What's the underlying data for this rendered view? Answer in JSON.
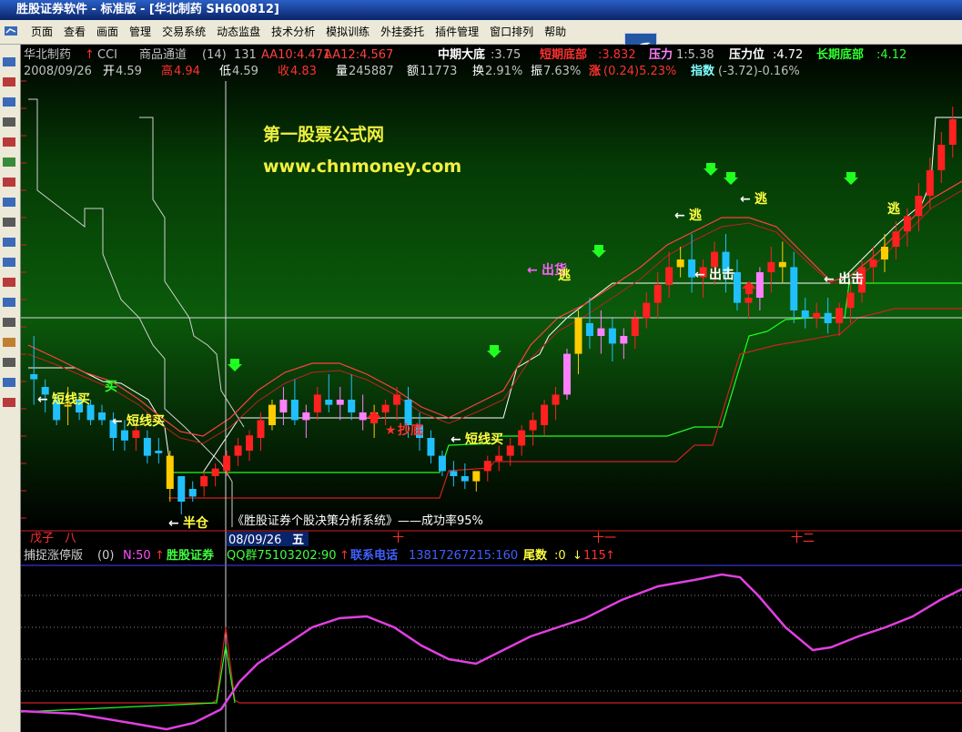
{
  "titlebar": {
    "text": "胜股证券软件 - 标准版 - [华北制药 SH600812]"
  },
  "menu": [
    "页面",
    "查看",
    "画面",
    "管理",
    "交易系统",
    "动态监盘",
    "技术分析",
    "模拟训练",
    "外挂委托",
    "插件管理",
    "窗口排列",
    "帮助"
  ],
  "header1": {
    "name": "华北制药",
    "ind": "CCI",
    "indname": "商品通道",
    "param": "(14)",
    "cci": "131",
    "aa10": "AA10:4.471",
    "aa12": "AA12:4.567",
    "mid_label": "中期大底",
    "mid_val": ":3.75",
    "short_label": "短期底部",
    "short_val": ":3.832",
    "press_label": "压力",
    "press_val": "1:5.38",
    "pos_label": "压力位",
    "pos_val": ":4.72",
    "long_label": "长期底部",
    "long_val": ":4.12"
  },
  "header2": {
    "date": "2008/09/26",
    "open_l": "开",
    "open_v": "4.59",
    "high_l": "高",
    "high_v": "4.94",
    "low_l": "低",
    "low_v": "4.59",
    "close_l": "收",
    "close_v": "4.83",
    "vol_l": "量",
    "vol_v": "245887",
    "amt_l": "额",
    "amt_v": "11773",
    "turn_l": "换",
    "turn_v": "2.91%",
    "amp_l": "振",
    "amp_v": "7.63%",
    "chg_l": "涨",
    "chg_v": "(0.24)5.23%",
    "idx_l": "指数",
    "idx_v": "(-3.72)-0.16%"
  },
  "watermark": {
    "line1": "第一股票公式网",
    "line2": "www.chnmoney.com"
  },
  "bottom_caption": "《胜股证券个股决策分析系统》——成功率95%",
  "labels": {
    "short_buy": "短线买",
    "buy": "买",
    "half_pos": "半仓",
    "copy_bottom": "抄底",
    "escape": "逃",
    "out": "出击",
    "outgoods": "出货"
  },
  "months": {
    "m1": "戊子",
    "m2": "八",
    "m3": "十",
    "m4": "十一",
    "m5": "十二"
  },
  "cursor_date": "08/09/26",
  "cursor_day": "五",
  "sub_header": {
    "name": "捕捉涨停版",
    "param": "(0)",
    "n": "N:50",
    "brand": "胜股证券",
    "qq": "QQ群75103202:90",
    "tel_l": "联系电话",
    "tel_v": "13817267215:160",
    "tail_l": "尾数",
    "tail_v": ":0",
    "last": "115"
  },
  "chart_data": {
    "type": "candlestick",
    "candles": [
      [
        4.3,
        4.45,
        4.28,
        4.18
      ],
      [
        4.25,
        4.28,
        4.22,
        4.15
      ],
      [
        4.2,
        4.22,
        4.12,
        4.1
      ],
      [
        4.18,
        4.25,
        4.18,
        4.1
      ],
      [
        4.2,
        4.22,
        4.15,
        4.12
      ],
      [
        4.18,
        4.2,
        4.12,
        4.1
      ],
      [
        4.15,
        4.18,
        4.12,
        4.1
      ],
      [
        4.12,
        4.15,
        4.05,
        4.0
      ],
      [
        4.08,
        4.12,
        4.04,
        4.0
      ],
      [
        4.05,
        4.1,
        4.08,
        4.0
      ],
      [
        4.05,
        4.08,
        3.98,
        3.95
      ],
      [
        4.0,
        4.05,
        3.99,
        3.95
      ],
      [
        3.98,
        4.0,
        3.85,
        3.8
      ],
      [
        3.9,
        3.9,
        3.8,
        3.75
      ],
      [
        3.85,
        3.88,
        3.82,
        3.8
      ],
      [
        3.86,
        3.92,
        3.9,
        3.82
      ],
      [
        3.9,
        3.95,
        3.93,
        3.86
      ],
      [
        3.92,
        4.0,
        3.98,
        3.9
      ],
      [
        3.98,
        4.05,
        4.02,
        3.94
      ],
      [
        4.0,
        4.08,
        4.06,
        3.96
      ],
      [
        4.05,
        4.15,
        4.12,
        4.0
      ],
      [
        4.1,
        4.2,
        4.18,
        4.08
      ],
      [
        4.15,
        4.25,
        4.2,
        4.1
      ],
      [
        4.2,
        4.28,
        4.12,
        4.1
      ],
      [
        4.12,
        4.18,
        4.15,
        4.05
      ],
      [
        4.15,
        4.25,
        4.22,
        4.12
      ],
      [
        4.2,
        4.3,
        4.18,
        4.15
      ],
      [
        4.18,
        4.25,
        4.2,
        4.12
      ],
      [
        4.2,
        4.3,
        4.15,
        4.12
      ],
      [
        4.15,
        4.22,
        4.12,
        4.08
      ],
      [
        4.12,
        4.18,
        4.15,
        4.05
      ],
      [
        4.15,
        4.2,
        4.18,
        4.1
      ],
      [
        4.18,
        4.25,
        4.22,
        4.12
      ],
      [
        4.2,
        4.25,
        4.1,
        4.05
      ],
      [
        4.1,
        4.15,
        4.05,
        4.0
      ],
      [
        4.05,
        4.08,
        3.98,
        3.95
      ],
      [
        3.98,
        4.0,
        3.92,
        3.9
      ],
      [
        3.92,
        3.96,
        3.9,
        3.86
      ],
      [
        3.9,
        3.95,
        3.88,
        3.85
      ],
      [
        3.88,
        3.92,
        3.92,
        3.84
      ],
      [
        3.92,
        3.98,
        3.96,
        3.88
      ],
      [
        3.96,
        4.02,
        3.98,
        3.92
      ],
      [
        3.98,
        4.05,
        4.02,
        3.94
      ],
      [
        4.02,
        4.1,
        4.08,
        3.98
      ],
      [
        4.08,
        4.15,
        4.12,
        4.02
      ],
      [
        4.1,
        4.2,
        4.18,
        4.06
      ],
      [
        4.18,
        4.25,
        4.22,
        4.12
      ],
      [
        4.22,
        4.4,
        4.38,
        4.2
      ],
      [
        4.38,
        4.55,
        4.52,
        4.3
      ],
      [
        4.5,
        4.6,
        4.45,
        4.4
      ],
      [
        4.45,
        4.55,
        4.48,
        4.38
      ],
      [
        4.48,
        4.52,
        4.42,
        4.35
      ],
      [
        4.42,
        4.48,
        4.45,
        4.36
      ],
      [
        4.45,
        4.55,
        4.52,
        4.4
      ],
      [
        4.52,
        4.62,
        4.58,
        4.48
      ],
      [
        4.58,
        4.7,
        4.65,
        4.52
      ],
      [
        4.65,
        4.78,
        4.72,
        4.6
      ],
      [
        4.72,
        4.8,
        4.75,
        4.68
      ],
      [
        4.75,
        4.85,
        4.68,
        4.62
      ],
      [
        4.68,
        4.75,
        4.72,
        4.6
      ],
      [
        4.72,
        4.82,
        4.78,
        4.65
      ],
      [
        4.78,
        4.85,
        4.7,
        4.62
      ],
      [
        4.7,
        4.75,
        4.58,
        4.55
      ],
      [
        4.58,
        4.65,
        4.6,
        4.52
      ],
      [
        4.6,
        4.72,
        4.7,
        4.55
      ],
      [
        4.7,
        4.8,
        4.74,
        4.62
      ],
      [
        4.74,
        4.82,
        4.72,
        4.66
      ],
      [
        4.72,
        4.78,
        4.55,
        4.5
      ],
      [
        4.55,
        4.6,
        4.52,
        4.48
      ],
      [
        4.52,
        4.58,
        4.54,
        4.48
      ],
      [
        4.54,
        4.6,
        4.5,
        4.46
      ],
      [
        4.5,
        4.58,
        4.56,
        4.45
      ],
      [
        4.56,
        4.65,
        4.62,
        4.5
      ],
      [
        4.62,
        4.75,
        4.72,
        4.58
      ],
      [
        4.72,
        4.8,
        4.75,
        4.66
      ],
      [
        4.75,
        4.85,
        4.8,
        4.7
      ],
      [
        4.8,
        4.9,
        4.86,
        4.75
      ],
      [
        4.86,
        4.95,
        4.92,
        4.8
      ],
      [
        4.92,
        5.05,
        5.0,
        4.86
      ],
      [
        5.0,
        5.15,
        5.1,
        4.95
      ],
      [
        5.1,
        5.25,
        5.2,
        5.05
      ],
      [
        5.2,
        5.35,
        5.3,
        5.15
      ]
    ],
    "ylim": [
      3.7,
      5.45
    ]
  }
}
